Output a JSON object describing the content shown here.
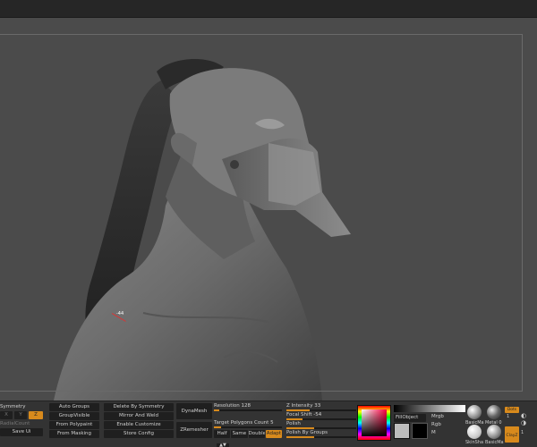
{
  "geometry": {
    "symmetry_label": "Symmetry",
    "xyz": [
      "X",
      "Y",
      "Z"
    ],
    "ubuttons": [
      "RadialCount",
      "Save Ui"
    ]
  },
  "polygroups": [
    "Auto Groups",
    "GroupVisible",
    "From Polypaint",
    "From Masking"
  ],
  "tools": [
    "Delete By Symmetry",
    "Mirror And Weld",
    "Enable Customize",
    "Store Config"
  ],
  "dynamesh": {
    "button": "DynaMesh",
    "resolution_label": "Resolution",
    "resolution_value": "128",
    "resolution_fraction": 0.08
  },
  "zremesher": {
    "button": "ZRemesher",
    "target_label": "Target Polygons Count",
    "target_value": "5",
    "target_fraction": 0.1,
    "options": [
      "Half",
      "Same",
      "Double",
      "Adapt"
    ]
  },
  "deformation": {
    "z_intensity_label": "Z Intensity",
    "z_intensity_value": "33",
    "z_intensity_fraction": 0.33,
    "focal_shift_label": "Focal Shift",
    "focal_shift_value": "-54",
    "focal_shift_fraction": 0.23,
    "polish_label": "Polish",
    "polish_fraction": 0.4,
    "polish_by_groups_label": "Polish By Groups",
    "polish_by_groups_fraction": 0.4
  },
  "color": {
    "fill_object": "FillObject",
    "mrgb": "Mrgb",
    "rgb": "Rgb",
    "m": "M",
    "accent": "#d88a1c"
  },
  "materials": {
    "basic_mat": "BasicMa",
    "metal": "Metal 0",
    "skin_shade": "SkinSha",
    "basic_mat2": "BasicMa",
    "dots_label": "Dots",
    "clayz_label": "ClayZ",
    "clayz_num": "1",
    "dots_num": "1"
  },
  "brush_cursor_label": "-44"
}
